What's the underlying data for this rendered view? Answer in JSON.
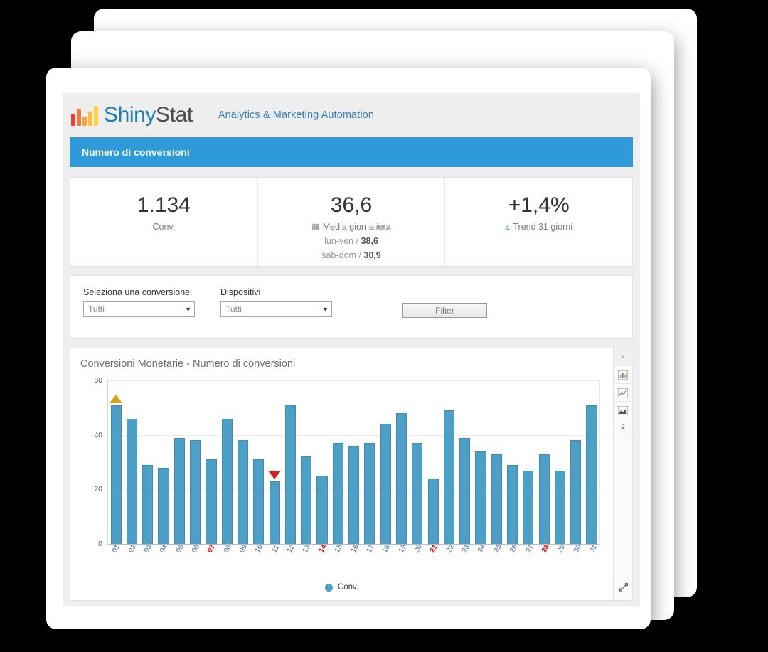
{
  "header": {
    "logo_text_1": "Shiny",
    "logo_text_2": "Stat",
    "tagline": "Analytics & Marketing Automation"
  },
  "title_bar": {
    "text": "Numero di conversioni"
  },
  "kpis": [
    {
      "value": "1.134",
      "label": "Conv.",
      "icon": "",
      "sub1": "",
      "sub2": ""
    },
    {
      "value": "36,6",
      "label": "Media giornaliera",
      "icon": "calendar-icon",
      "sub1_label": "lun-ven /",
      "sub1_value": "38,6",
      "sub2_label": "sab-dom /",
      "sub2_value": "30,9"
    },
    {
      "value": "+1,4%",
      "label": "Trend 31 giorni",
      "icon": "caret-up-icon"
    }
  ],
  "filters": {
    "conversion": {
      "label": "Seleziona una conversione",
      "value": "Tutti",
      "caret": "▼"
    },
    "devices": {
      "label": "Dispositivi",
      "value": "Tutti",
      "caret": "▼"
    },
    "button": "Filter"
  },
  "chart_panel": {
    "title": "Conversioni Monetarie - Numero di conversioni",
    "legend_label": "Conv.",
    "tools": [
      {
        "name": "collapse-toolbar",
        "glyph": "«"
      },
      {
        "name": "bar-chart-view",
        "glyph": "bar"
      },
      {
        "name": "line-chart-view",
        "glyph": "line"
      },
      {
        "name": "area-chart-view",
        "glyph": "area"
      },
      {
        "name": "mean-toggle",
        "glyph": "x̄"
      }
    ],
    "expand_icon": "expand-diagonal-icon"
  },
  "colors": {
    "accent_blue": "#2f9ad9",
    "bar_blue": "#4d9fc6",
    "max_marker": "#d8a116",
    "min_marker": "#cc2222",
    "weekend_red": "#e60000",
    "trend_green": "#2e9b53"
  },
  "chart_data": {
    "type": "bar",
    "title": "Conversioni Monetarie - Numero di conversioni",
    "xlabel": "",
    "ylabel": "",
    "ylim": [
      0,
      60
    ],
    "yticks": [
      0,
      20,
      40,
      60
    ],
    "grid": true,
    "legend_position": "bottom",
    "legend": [
      "Conv."
    ],
    "categories": [
      "01",
      "02",
      "03",
      "04",
      "05",
      "06",
      "07",
      "08",
      "09",
      "10",
      "11",
      "12",
      "13",
      "14",
      "15",
      "16",
      "17",
      "18",
      "19",
      "20",
      "21",
      "22",
      "23",
      "24",
      "25",
      "26",
      "27",
      "28",
      "29",
      "30",
      "31"
    ],
    "weekend_categories": [
      "07",
      "14",
      "21",
      "28"
    ],
    "series": [
      {
        "name": "Conv.",
        "values": [
          51,
          46,
          29,
          28,
          39,
          38,
          31,
          46,
          38,
          31,
          23,
          51,
          32,
          25,
          37,
          36,
          37,
          44,
          48,
          37,
          24,
          49,
          39,
          34,
          33,
          29,
          27,
          33,
          27,
          38,
          51
        ]
      }
    ],
    "annotations": [
      {
        "type": "max-marker",
        "category": "01",
        "value": 51
      },
      {
        "type": "min-marker",
        "category": "11",
        "value": 23
      }
    ]
  }
}
